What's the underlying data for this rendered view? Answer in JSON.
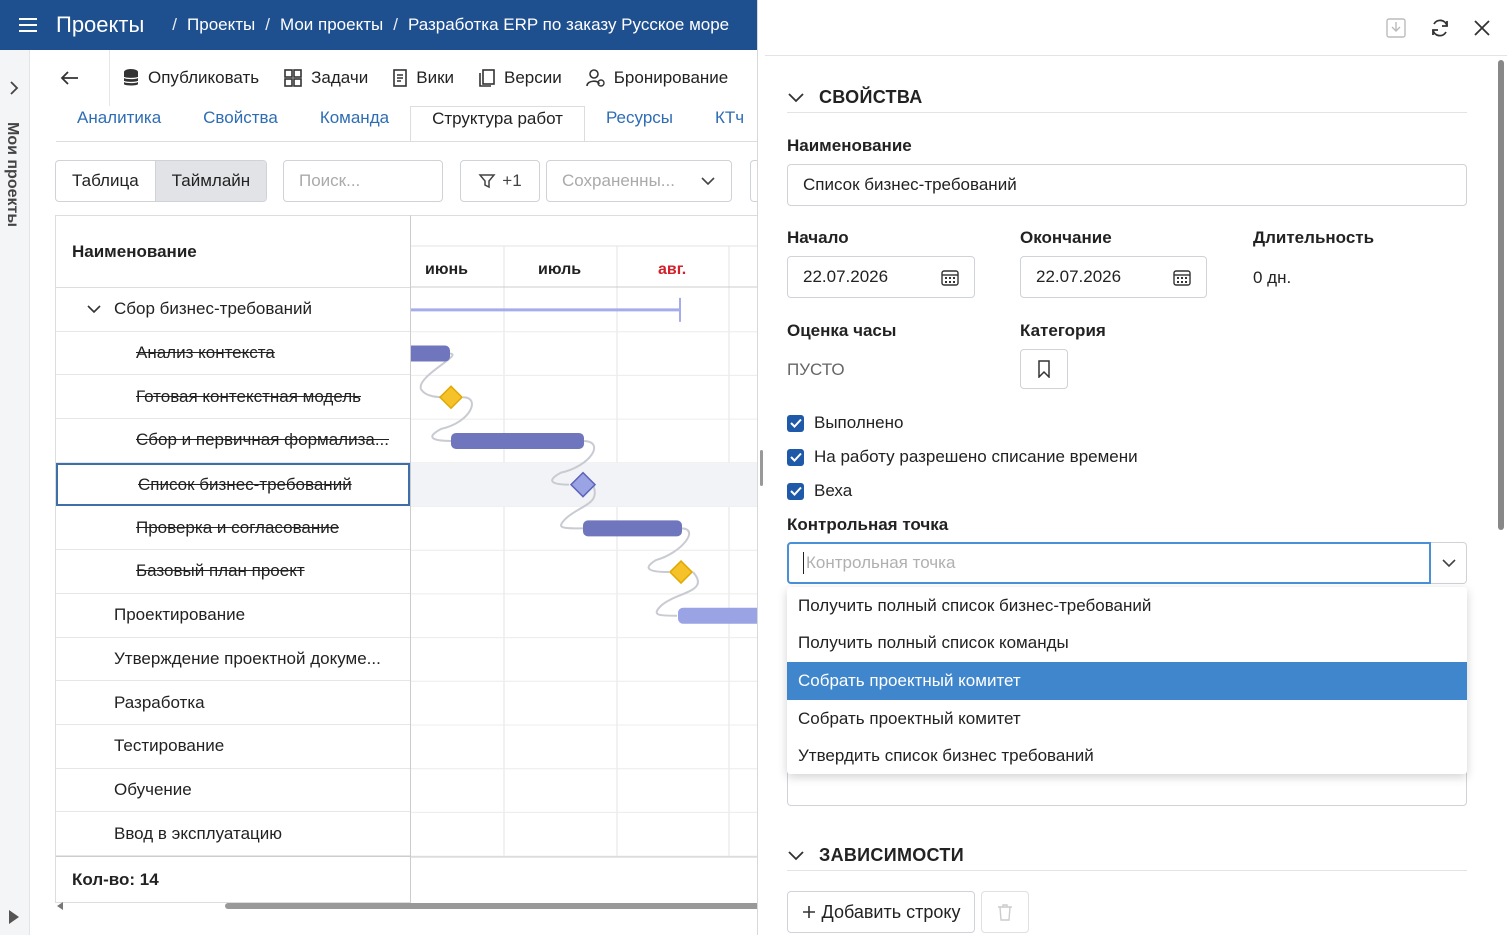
{
  "topbar": {
    "title": "Проекты",
    "breadcrumbs": [
      "Проекты",
      "Мои проекты",
      "Разработка ERP по заказу Русское море"
    ]
  },
  "rail": {
    "label": "Мои проекты"
  },
  "toolbar": {
    "publish": "Опубликовать",
    "tasks": "Задачи",
    "wiki": "Вики",
    "versions": "Версии",
    "booking": "Бронирование"
  },
  "tabs": [
    "Аналитика",
    "Свойства",
    "Команда",
    "Структура работ",
    "Ресурсы",
    "КТч"
  ],
  "view": {
    "table": "Таблица",
    "timeline": "Таймлайн"
  },
  "search": {
    "placeholder": "Поиск..."
  },
  "filter": {
    "count": "+1"
  },
  "saved": {
    "placeholder": "Сохраненны..."
  },
  "gantt": {
    "column": "Наименование",
    "months": [
      "июнь",
      "июль",
      "авг."
    ],
    "rows": [
      {
        "name": "Сбор бизнес-требований",
        "level": 1,
        "done": false,
        "group": true
      },
      {
        "name": "Анализ контекста",
        "level": 2,
        "done": true
      },
      {
        "name": "Готовая контекстная модель",
        "level": 2,
        "done": true
      },
      {
        "name": "Сбор и первичная формализа...",
        "level": 2,
        "done": true
      },
      {
        "name": "Список бизнес-требований",
        "level": 2,
        "done": true,
        "selected": true
      },
      {
        "name": "Проверка и согласование",
        "level": 2,
        "done": true
      },
      {
        "name": "Базовый план проект",
        "level": 2,
        "done": true
      },
      {
        "name": "Проектирование",
        "level": 1,
        "done": false
      },
      {
        "name": "Утверждение проектной докуме...",
        "level": 1,
        "done": false
      },
      {
        "name": "Разработка",
        "level": 1,
        "done": false
      },
      {
        "name": "Тестирование",
        "level": 1,
        "done": false
      },
      {
        "name": "Обучение",
        "level": 1,
        "done": false
      },
      {
        "name": "Ввод в эксплуатацию",
        "level": 1,
        "done": false
      }
    ],
    "footer": "Кол-во: 14"
  },
  "panel": {
    "properties_header": "СВОЙСТВА",
    "name_label": "Наименование",
    "name_value": "Список бизнес-требований",
    "start_label": "Начало",
    "start_value": "22.07.2026",
    "end_label": "Окончание",
    "end_value": "22.07.2026",
    "duration_label": "Длительность",
    "duration_value": "0 дн.",
    "estimate_label": "Оценка часы",
    "estimate_value": "ПУСТО",
    "category_label": "Категория",
    "checks": [
      "Выполнено",
      "На работу разрешено списание времени",
      "Веха"
    ],
    "checkpoint_label": "Контрольная точка",
    "checkpoint_placeholder": "Контрольная точка",
    "options": [
      "Получить полный список бизнес-требований",
      "Получить полный список команды",
      "Собрать проектный комитет",
      "Собрать проектный комитет",
      "Утвердить список бизнес требований"
    ],
    "highlighted_option": 2,
    "deps_header": "ЗАВИСИМОСТИ",
    "add_row": "Добавить строку"
  },
  "colors": {
    "topbar": "#1e4f8f",
    "accent": "#1e5aa8",
    "bar": "#7076bd",
    "bar_light": "#9aa3e4",
    "milestone": "#f6c22a",
    "month_current": "#d4202a"
  }
}
